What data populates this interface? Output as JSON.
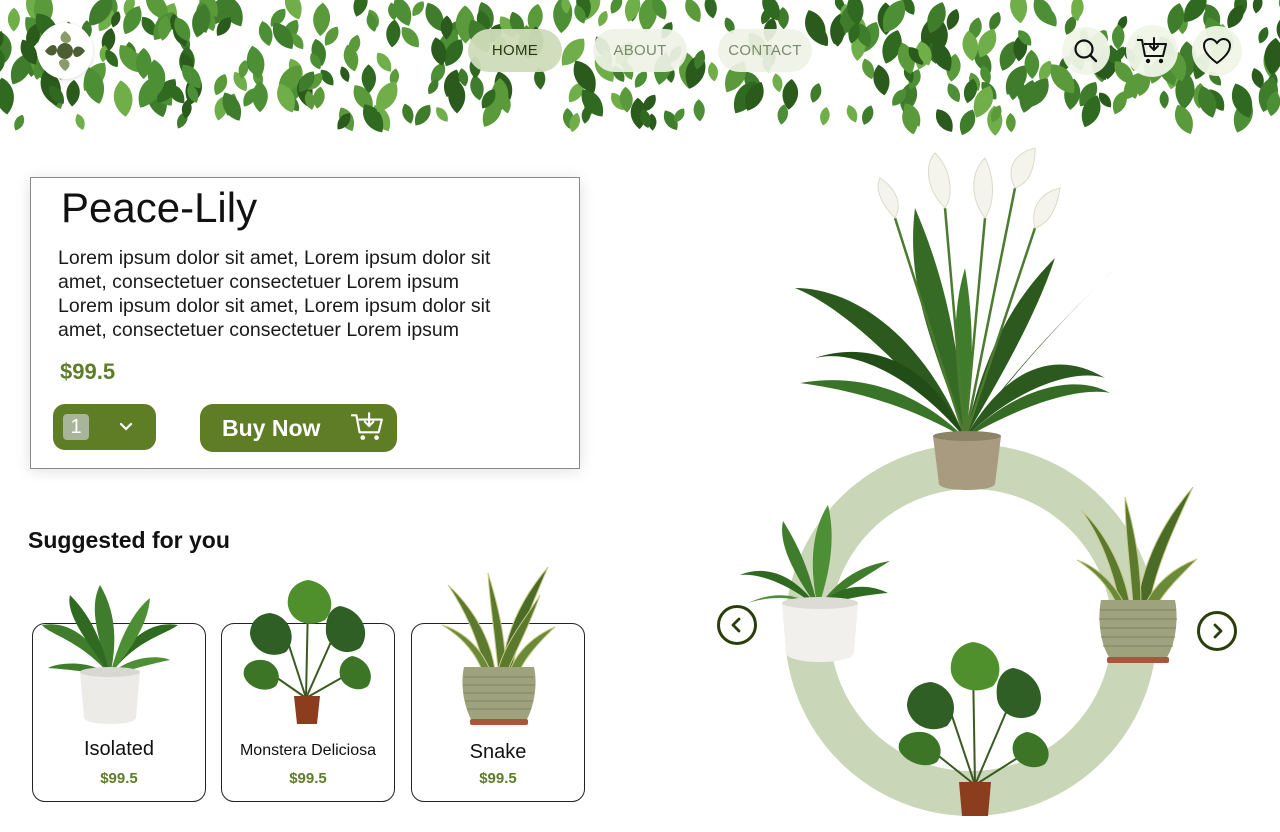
{
  "nav": {
    "home": "HOME",
    "about": "ABOUT",
    "contact": "CONTACT"
  },
  "header_icons": [
    "search-icon",
    "cart-download-icon",
    "heart-icon"
  ],
  "product": {
    "title": "Peace-Lily",
    "description": "Lorem ipsum dolor sit amet, Lorem ipsum dolor sit\namet, consectetuer  consectetuer Lorem ipsum\nLorem ipsum dolor sit amet, Lorem ipsum dolor sit\namet, consectetuer  consectetuer Lorem ipsum",
    "price": "$99.5",
    "quantity": "1",
    "buy_label": "Buy Now"
  },
  "suggested": {
    "title": "Suggested for you",
    "items": [
      {
        "name": "Isolated",
        "price": "$99.5"
      },
      {
        "name": "Monstera Deliciosa",
        "price": "$99.5"
      },
      {
        "name": "Snake",
        "price": "$99.5"
      }
    ]
  },
  "colors": {
    "accent_green": "#5f7d25",
    "price_green": "#5e7d29",
    "ring_green": "#c9d6b8",
    "nav_active": "#cddcb9"
  }
}
